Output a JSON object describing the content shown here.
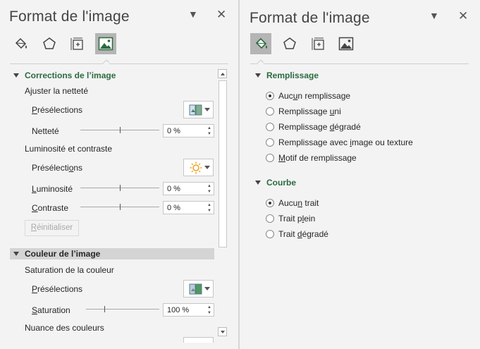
{
  "left": {
    "title": "Format de l'image",
    "sections": {
      "corrections": {
        "header": "Corrections de l’image",
        "sharpen_label": "Ajuster la netteté",
        "presets1": "Présélections",
        "sharpness_label": "Netteté",
        "sharpness_value": "0 %",
        "brightness_contrast_label": "Luminosité et contraste",
        "presets2": "Présélections",
        "brightness_label": "Luminosité",
        "brightness_value": "0 %",
        "contrast_label": "Contraste",
        "contrast_value": "0 %",
        "reset_label": "Réinitialiser"
      },
      "color": {
        "header": "Couleur de l’image",
        "saturation_section_label": "Saturation de la couleur",
        "presets3": "Présélections",
        "saturation_label": "Saturation",
        "saturation_value": "100 %",
        "tone_label": "Nuance des couleurs"
      }
    },
    "sliders": {
      "sharpness": 0.5,
      "brightness": 0.5,
      "contrast": 0.5,
      "saturation": 0.25
    }
  },
  "right": {
    "title": "Format de l'image",
    "fill": {
      "header": "Remplissage",
      "options": [
        {
          "label": "Aucun remplissage",
          "selected": true
        },
        {
          "label": "Remplissage uni",
          "selected": false
        },
        {
          "label": "Remplissage dégradé",
          "selected": false
        },
        {
          "label": "Remplissage avec image ou texture",
          "selected": false
        },
        {
          "label": "Motif de remplissage",
          "selected": false
        }
      ]
    },
    "line": {
      "header": "Courbe",
      "options": [
        {
          "label": "Aucun trait",
          "selected": true
        },
        {
          "label": "Trait plein",
          "selected": false
        },
        {
          "label": "Trait dégradé",
          "selected": false
        }
      ]
    }
  },
  "icons": {
    "tab1": "fill-bucket-icon",
    "tab2": "pentagon-effects-icon",
    "tab3": "size-properties-icon",
    "tab4": "picture-icon"
  },
  "colors": {
    "accent_green": "#2b6a3f",
    "active_tab": "#b5b5b5",
    "sun": "#f0a020"
  }
}
